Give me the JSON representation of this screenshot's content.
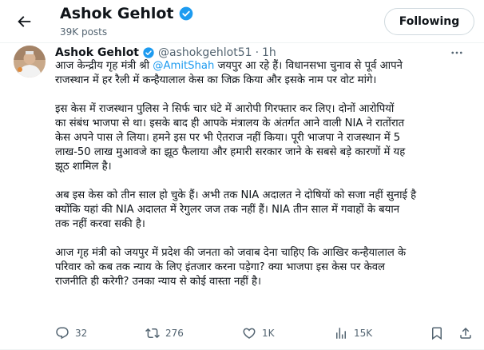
{
  "header": {
    "title": "Ashok Gehlot",
    "post_count": "39K posts",
    "follow_label": "Following"
  },
  "tweet": {
    "author_name": "Ashok Gehlot",
    "handle": "@ashokgehlot51",
    "separator": "·",
    "time": "1h",
    "paragraphs": [
      {
        "lines": [
          {
            "before": "आज केन्द्रीय गृह मंत्री श्री ",
            "mention": "@AmitShah",
            "after": " जयपुर आ रहे हैं। विधानसभा चुनाव से पूर्व आपने"
          },
          {
            "text": "राजस्थान में हर रैली में कन्हैयालाल केस का जिक्र किया और इसके नाम पर वोट मांगे।"
          }
        ]
      },
      {
        "lines": [
          {
            "text": "इस केस में राजस्थान पुलिस ने सिर्फ चार घंटे में आरोपी गिरफ्तार कर लिए। दोनों आरोपियों"
          },
          {
            "text": "का संबंध भाजपा से था। इसके बाद ही आपके मंत्रालय के अंतर्गत आने वाली NIA ने रातोंरात"
          },
          {
            "text": "केस अपने पास ले लिया। हमने इस पर भी ऐतराज नहीं किया। पूरी भाजपा ने राजस्थान में 5"
          },
          {
            "text": "लाख-50 लाख मुआवजे का झूठ फैलाया और हमारी सरकार जाने के सबसे बड़े कारणों में यह"
          },
          {
            "text": "झूठ शामिल है।"
          }
        ]
      },
      {
        "lines": [
          {
            "text": "अब इस केस को तीन साल हो चुके हैं। अभी तक NIA अदालत ने दोषियों को सजा नहीं सुनाई है"
          },
          {
            "text": "क्योंकि यहां की NIA अदालत में रेगुलर जज तक नहीं हैं। NIA तीन साल में गवाहों के बयान"
          },
          {
            "text": "तक नहीं करवा सकी है।"
          }
        ]
      },
      {
        "lines": [
          {
            "text": "आज गृह मंत्री को जयपुर में प्रदेश की जनता को जवाब देना चाहिए कि आखिर कन्हैयालाल के"
          },
          {
            "text": "परिवार को कब तक न्याय के लिए इंतजार करना पड़ेगा? क्या भाजपा इस केस पर केवल"
          },
          {
            "text": "राजनीति ही करेगी? उनका न्याय से कोई वास्ता नहीं है।"
          }
        ]
      }
    ],
    "stats": {
      "replies": "32",
      "reposts": "276",
      "likes": "1K",
      "views": "15K"
    }
  },
  "colors": {
    "accent": "#1d9bf0",
    "text": "#0f1419",
    "muted": "#536471",
    "border": "#eff3f4"
  },
  "icons": [
    "back-arrow-icon",
    "verified-badge-icon",
    "more-icon",
    "reply-icon",
    "repost-icon",
    "like-icon",
    "views-icon",
    "bookmark-icon",
    "share-icon"
  ]
}
